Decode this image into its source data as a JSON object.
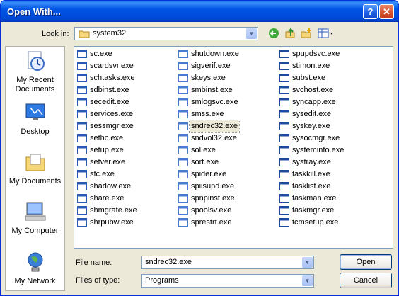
{
  "window": {
    "title": "Open With..."
  },
  "titlebar": {
    "help_label": "?",
    "close_label": "✕"
  },
  "toolbar": {
    "look_in_label": "Look in:",
    "look_in_value": "system32",
    "back_icon": "back-arrow-icon",
    "up_icon": "up-folder-icon",
    "new_folder_icon": "new-folder-icon",
    "views_icon": "views-menu-icon"
  },
  "places": [
    {
      "label": "My Recent Documents",
      "icon": "recent-documents-icon"
    },
    {
      "label": "Desktop",
      "icon": "desktop-icon"
    },
    {
      "label": "My Documents",
      "icon": "my-documents-icon"
    },
    {
      "label": "My Computer",
      "icon": "my-computer-icon"
    },
    {
      "label": "My Network",
      "icon": "my-network-icon"
    }
  ],
  "files": {
    "col1": [
      "sc.exe",
      "scardsvr.exe",
      "schtasks.exe",
      "sdbinst.exe",
      "secedit.exe",
      "services.exe",
      "sessmgr.exe",
      "sethc.exe",
      "setup.exe",
      "setver.exe",
      "sfc.exe",
      "shadow.exe",
      "share.exe",
      "shmgrate.exe",
      "shrpubw.exe"
    ],
    "col2": [
      "shutdown.exe",
      "sigverif.exe",
      "skeys.exe",
      "smbinst.exe",
      "smlogsvc.exe",
      "smss.exe",
      "sndrec32.exe",
      "sndvol32.exe",
      "sol.exe",
      "sort.exe",
      "spider.exe",
      "spiisupd.exe",
      "spnpinst.exe",
      "spoolsv.exe",
      "sprestrt.exe"
    ],
    "col3": [
      "spupdsvc.exe",
      "stimon.exe",
      "subst.exe",
      "svchost.exe",
      "syncapp.exe",
      "sysedit.exe",
      "syskey.exe",
      "sysocmgr.exe",
      "systeminfo.exe",
      "systray.exe",
      "taskkill.exe",
      "tasklist.exe",
      "taskman.exe",
      "taskmgr.exe",
      "tcmsetup.exe"
    ],
    "selected": "sndrec32.exe"
  },
  "form": {
    "file_name_label": "File name:",
    "file_name_value": "sndrec32.exe",
    "file_type_label": "Files of type:",
    "file_type_value": "Programs",
    "open_label": "Open",
    "cancel_label": "Cancel"
  }
}
